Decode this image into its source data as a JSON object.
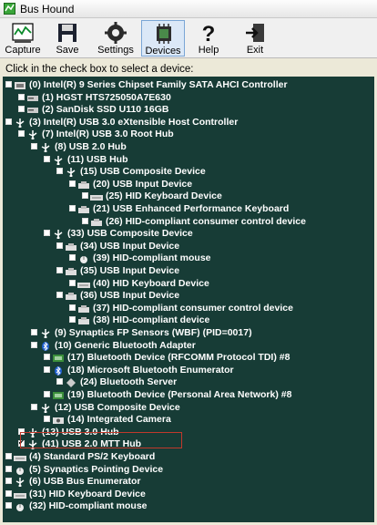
{
  "window": {
    "title": "Bus Hound"
  },
  "toolbar": {
    "buttons": [
      {
        "label": "Capture",
        "icon": "capture-icon"
      },
      {
        "label": "Save",
        "icon": "disk-icon"
      },
      {
        "label": "Settings",
        "icon": "gear-icon"
      },
      {
        "label": "Devices",
        "icon": "chip-icon",
        "active": true
      },
      {
        "label": "Help",
        "icon": "question-icon"
      },
      {
        "label": "Exit",
        "icon": "exit-icon"
      }
    ]
  },
  "hint": "Click in the check box to select a device:",
  "tree": {
    "items": [
      {
        "label": "(0) Intel(R) 9 Series Chipset Family SATA AHCI Controller",
        "depth": 0,
        "icon": "controller-icon"
      },
      {
        "label": "(1) HGST HTS725050A7E630",
        "depth": 1,
        "icon": "disk-drive-icon"
      },
      {
        "label": "(2) SanDisk SSD U110 16GB",
        "depth": 1,
        "icon": "disk-drive-icon"
      },
      {
        "label": "(3) Intel(R) USB 3.0 eXtensible Host Controller",
        "depth": 0,
        "icon": "usb-icon"
      },
      {
        "label": "(7) Intel(R) USB 3.0 Root Hub",
        "depth": 1,
        "icon": "usb-icon"
      },
      {
        "label": "(8) USB 2.0 Hub",
        "depth": 2,
        "icon": "usb-icon"
      },
      {
        "label": "(11) USB Hub",
        "depth": 3,
        "icon": "usb-icon"
      },
      {
        "label": "(15) USB Composite Device",
        "depth": 4,
        "icon": "usb-icon"
      },
      {
        "label": "(20) USB Input Device",
        "depth": 5,
        "icon": "input-device-icon"
      },
      {
        "label": "(25) HID Keyboard Device",
        "depth": 6,
        "icon": "keyboard-icon"
      },
      {
        "label": "(21) USB Enhanced Performance Keyboard",
        "depth": 5,
        "icon": "input-device-icon"
      },
      {
        "label": "(26) HID-compliant consumer control device",
        "depth": 6,
        "icon": "input-device-icon"
      },
      {
        "label": "(33) USB Composite Device",
        "depth": 3,
        "icon": "usb-icon"
      },
      {
        "label": "(34) USB Input Device",
        "depth": 4,
        "icon": "input-device-icon"
      },
      {
        "label": "(39) HID-compliant mouse",
        "depth": 5,
        "icon": "mouse-icon"
      },
      {
        "label": "(35) USB Input Device",
        "depth": 4,
        "icon": "input-device-icon"
      },
      {
        "label": "(40) HID Keyboard Device",
        "depth": 5,
        "icon": "keyboard-icon"
      },
      {
        "label": "(36) USB Input Device",
        "depth": 4,
        "icon": "input-device-icon"
      },
      {
        "label": "(37) HID-compliant consumer control device",
        "depth": 5,
        "icon": "input-device-icon"
      },
      {
        "label": "(38) HID-compliant device",
        "depth": 5,
        "icon": "input-device-icon"
      },
      {
        "label": "(9) Synaptics FP Sensors (WBF) (PID=0017)",
        "depth": 2,
        "icon": "usb-icon"
      },
      {
        "label": "(10) Generic Bluetooth Adapter",
        "depth": 2,
        "icon": "bluetooth-icon"
      },
      {
        "label": "(17) Bluetooth Device (RFCOMM Protocol TDI) #8",
        "depth": 3,
        "icon": "network-icon"
      },
      {
        "label": "(18) Microsoft Bluetooth Enumerator",
        "depth": 3,
        "icon": "bluetooth-icon"
      },
      {
        "label": "(24) Bluetooth Server",
        "depth": 4,
        "icon": "diamond-icon"
      },
      {
        "label": "(19) Bluetooth Device (Personal Area Network) #8",
        "depth": 3,
        "icon": "network-icon"
      },
      {
        "label": "(12) USB Composite Device",
        "depth": 2,
        "icon": "usb-icon"
      },
      {
        "label": "(14) Integrated Camera",
        "depth": 3,
        "icon": "camera-icon"
      },
      {
        "label": "(13) USB 3.0 Hub",
        "depth": 1,
        "icon": "usb-icon"
      },
      {
        "label": "(41) USB 2.0 MTT Hub",
        "depth": 1,
        "icon": "usb-icon",
        "checked": true
      },
      {
        "label": "(4) Standard PS/2 Keyboard",
        "depth": 0,
        "icon": "keyboard-icon"
      },
      {
        "label": "(5) Synaptics Pointing Device",
        "depth": 0,
        "icon": "mouse-icon"
      },
      {
        "label": "(6) USB Bus Enumerator",
        "depth": 0,
        "icon": "usb-icon"
      },
      {
        "label": "(31) HID Keyboard Device",
        "depth": 0,
        "icon": "keyboard-icon"
      },
      {
        "label": "(32) HID-compliant mouse",
        "depth": 0,
        "icon": "mouse-icon"
      }
    ]
  }
}
